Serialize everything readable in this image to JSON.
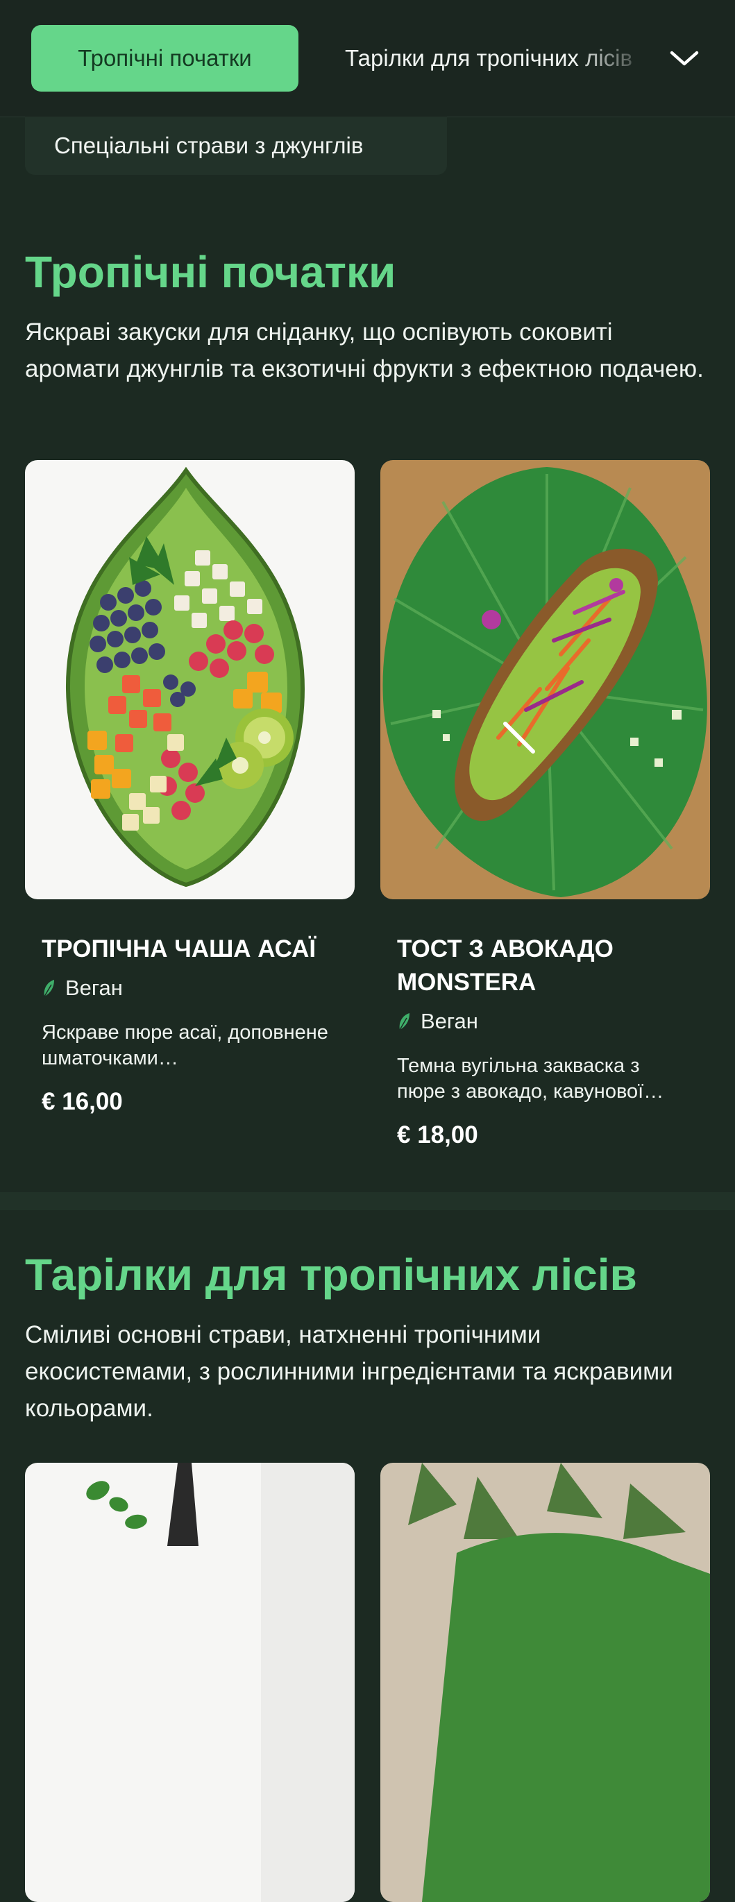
{
  "nav": {
    "active_tab": "Тропічні початки",
    "next_tab": "Тарілки для тропічних лісів",
    "extra_tab": "Спеціальні страви з джунглів"
  },
  "sections": [
    {
      "title": "Тропічні початки",
      "description": "Яскраві закуски для сніданку, що оспівують соковиті аромати джунглів та екзотичні фрукти з ефектною подачею.",
      "items": [
        {
          "name": "Тропічна чаша асаї",
          "tag": "Веган",
          "description": "Яскраве пюре асаї, доповнене шматочками…",
          "price": "€ 16,00",
          "image": "acai-bowl-leaf-dish"
        },
        {
          "name": "Тост з авокадо Monstera",
          "tag": "Веган",
          "description": "Темна вугільна закваска з пюре з авокадо, кавунової…",
          "price": "€ 18,00",
          "image": "avocado-toast-on-leaf"
        }
      ]
    },
    {
      "title": "Тарілки для тропічних лісів",
      "description": "Сміливі основні страви, натхненні тропічними екосистемами, з рослинними інгредієнтами та яскравими кольорами.",
      "items": [
        {
          "image": "basil-skillet-dish"
        },
        {
          "image": "leafy-dish"
        }
      ]
    }
  ],
  "colors": {
    "accent": "#65d68a",
    "background": "#1c2a22"
  }
}
